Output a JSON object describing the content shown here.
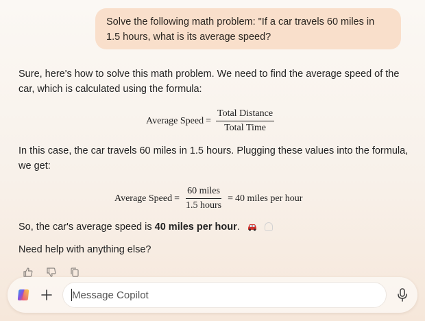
{
  "user_message": "Solve the following math problem: \"If a car travels 60 miles in 1.5 hours, what is its average speed?",
  "reply": {
    "para1": "Sure, here's how to solve this math problem. We need to find the average speed of the car, which is calculated using the formula:",
    "eq1": {
      "lhs": "Average Speed",
      "eq": "=",
      "num": "Total Distance",
      "den": "Total Time"
    },
    "para2": "In this case, the car travels 60 miles in 1.5 hours. Plugging these values into the formula, we get:",
    "eq2": {
      "lhs": "Average Speed",
      "eq": "=",
      "num": "60 miles",
      "den": "1.5 hours",
      "eq_b": "=",
      "result": "40 miles per hour"
    },
    "para3_prefix": "So, the car's average speed is ",
    "para3_bold": "40 miles per hour",
    "para3_suffix": ".",
    "para4": "Need help with anything else?"
  },
  "actions": [
    "thumbs-up-icon",
    "thumbs-down-icon",
    "copy-icon"
  ],
  "composer": {
    "placeholder": "Message Copilot"
  },
  "colors": {
    "user_bubble": "#f9dfcb",
    "background": "#f8f1ea"
  }
}
